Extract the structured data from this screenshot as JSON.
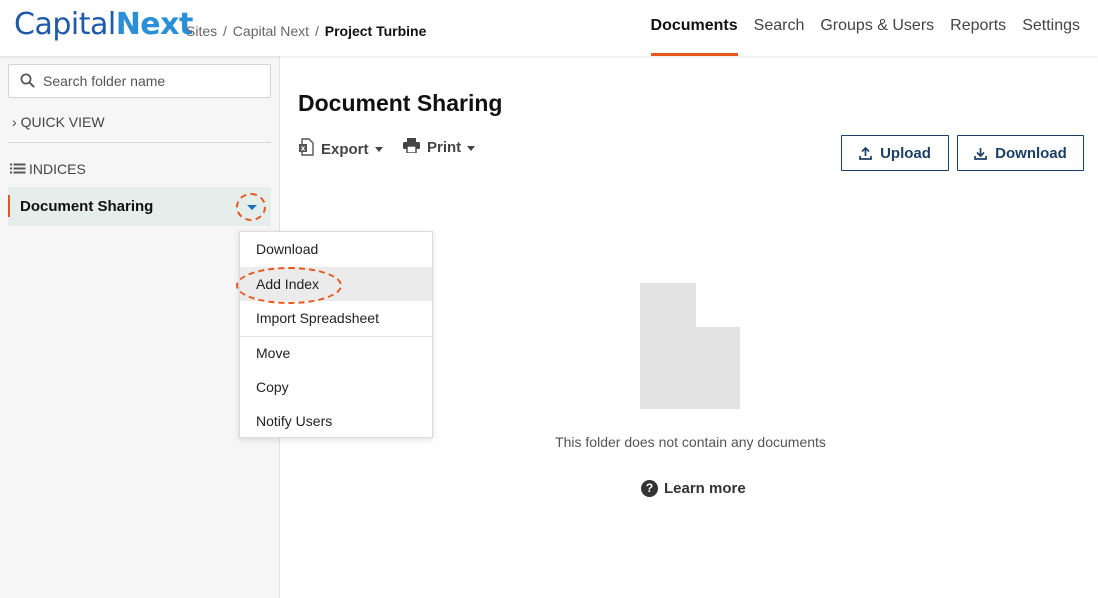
{
  "brand": {
    "capital": "Capital",
    "next": "Next"
  },
  "breadcrumb": {
    "sites": "Sites",
    "site": "Capital Next",
    "current": "Project Turbine",
    "separator": "/"
  },
  "nav": [
    {
      "label": "Documents",
      "active": true
    },
    {
      "label": "Search"
    },
    {
      "label": "Groups & Users"
    },
    {
      "label": "Reports"
    },
    {
      "label": "Settings"
    }
  ],
  "sidebar": {
    "search_placeholder": "Search folder name",
    "quick_view": "QUICK VIEW",
    "indices": "INDICES",
    "folder": "Document Sharing"
  },
  "context_menu": {
    "items": [
      "Download",
      "Add Index",
      "Import Spreadsheet",
      "Move",
      "Copy",
      "Notify Users"
    ],
    "highlighted": "Add Index"
  },
  "main": {
    "title": "Document Sharing",
    "export": "Export",
    "print": "Print",
    "upload": "Upload",
    "download": "Download",
    "empty_message": "This folder does not contain any documents",
    "learn_more": "Learn more",
    "help_glyph": "?"
  },
  "colors": {
    "accent": "#e8561c",
    "brand_dark": "#1f5aa8",
    "brand_light": "#2a8fd8",
    "button_border": "#1b3f66",
    "selected_folder_bg": "#e6eeeb"
  }
}
